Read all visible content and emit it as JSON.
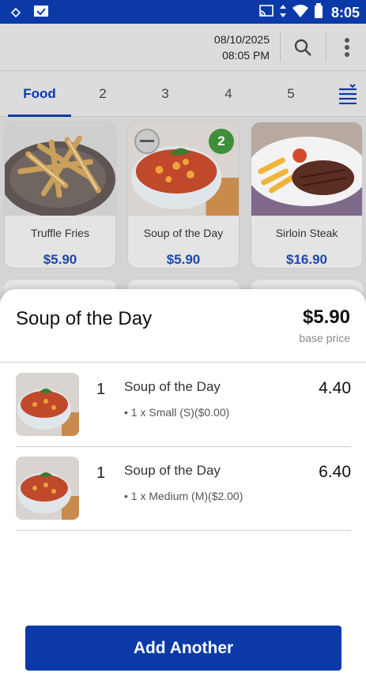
{
  "status_bar": {
    "time": "8:05",
    "icons": [
      "notification-icon",
      "check-icon",
      "cast-icon",
      "data-arrows-icon",
      "wifi-icon",
      "battery-icon"
    ]
  },
  "header": {
    "date": "08/10/2025",
    "time": "08:05 PM",
    "icons": [
      "search-icon",
      "more-vert-icon"
    ]
  },
  "tabs": [
    {
      "label": "Food",
      "active": true
    },
    {
      "label": "2"
    },
    {
      "label": "3"
    },
    {
      "label": "4"
    },
    {
      "label": "5"
    }
  ],
  "products": [
    {
      "name": "Truffle Fries",
      "price": "$5.90"
    },
    {
      "name": "Soup of the Day",
      "price": "$5.90",
      "count": "2"
    },
    {
      "name": "Sirloin Steak",
      "price": "$16.90"
    }
  ],
  "sheet": {
    "title": "Soup of the Day",
    "price": "$5.90",
    "price_caption": "base price",
    "items": [
      {
        "qty": "1",
        "name": "Soup of the Day",
        "option": "• 1 x Small (S)($0.00)",
        "amount": "4.40"
      },
      {
        "qty": "1",
        "name": "Soup of the Day",
        "option": "• 1 x Medium (M)($2.00)",
        "amount": "6.40"
      }
    ],
    "button_label": "Add Another"
  },
  "colors": {
    "brand_blue": "#0b3aa8",
    "price_blue": "#1b48b0",
    "badge_green": "#3f8f3a"
  }
}
